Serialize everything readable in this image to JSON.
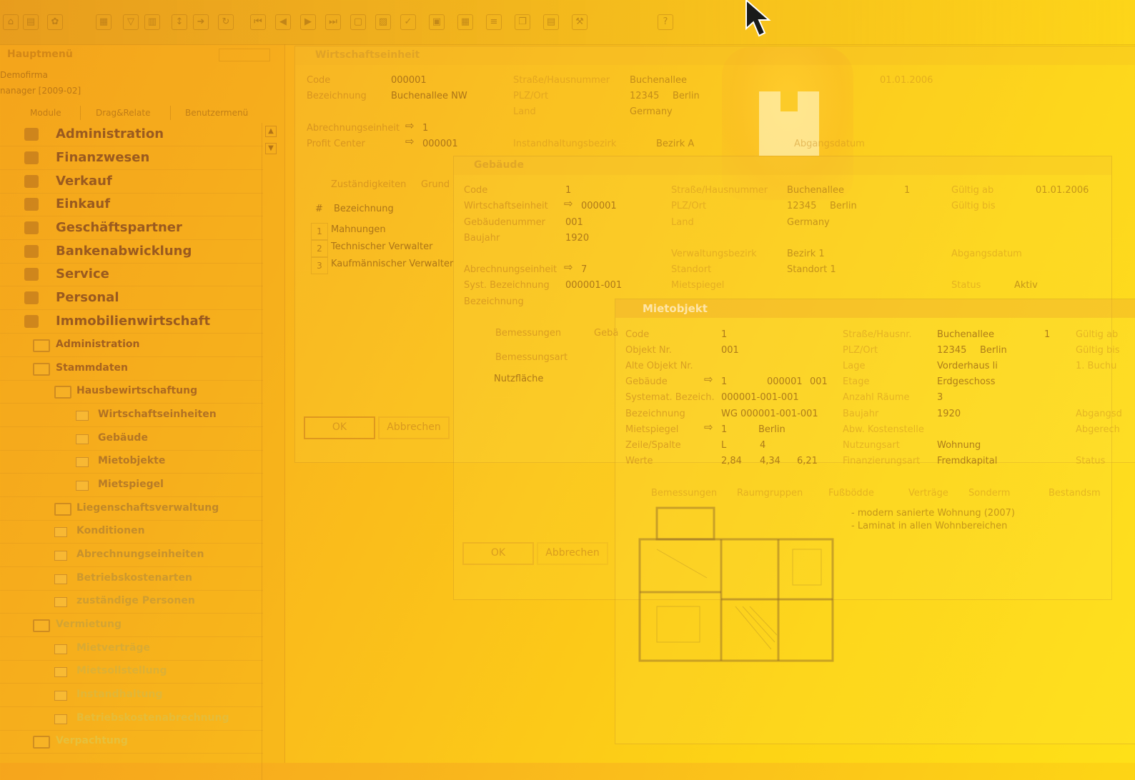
{
  "nav": {
    "title": "Hauptmenü",
    "company": "Demofirma",
    "version": "nanager  [2009-02]",
    "tabs": [
      "Module",
      "Drag&Relate",
      "Benutzermenü"
    ],
    "modules": [
      "Administration",
      "Finanzwesen",
      "Verkauf",
      "Einkauf",
      "Geschäftspartner",
      "Bankenabwicklung",
      "Service",
      "Personal",
      "Immobilienwirtschaft"
    ],
    "immo_children": {
      "administration": "Administration",
      "stammdaten": "Stammdaten",
      "hausbewirtschaftung": "Hausbewirtschaftung",
      "hb_items": [
        "Wirtschaftseinheiten",
        "Gebäude",
        "Mietobjekte",
        "Mietspiegel"
      ],
      "more": [
        "Liegenschaftsverwaltung",
        "Konditionen",
        "Abrechnungseinheiten",
        "Betriebskostenarten",
        "zuständige Personen"
      ],
      "vermietung": "Vermietung",
      "verm_items": [
        "Mietverträge",
        "Mietsollstellung",
        "Instandhaltung",
        "Betriebskostenabrechnung"
      ],
      "last": "Verpachtung"
    }
  },
  "w1": {
    "title": "Wirtschaftseinheit",
    "code_label": "Code",
    "code": "000001",
    "bez_label": "Bezeichnung",
    "bez": "Buchenallee NW",
    "str_label": "Straße/Hausnummer",
    "str": "Buchenallee",
    "plz_label": "PLZ/Ort",
    "plz": "12345",
    "ort": "Berlin",
    "land_label": "Land",
    "land": "Germany",
    "date": "01.01.2006",
    "ae_label": "Abrechnungseinheit",
    "ae": "1",
    "pc_label": "Profit Center",
    "pc": "000001",
    "ib_label": "Instandhaltungsbezirk",
    "ib": "Bezirk A",
    "abg_label": "Abgangsdatum",
    "tabs": [
      "Zuständigkeiten",
      "Grund"
    ],
    "grid_head": [
      "#",
      "Bezeichnung"
    ],
    "rows": [
      "Mahnungen",
      "Technischer Verwalter",
      "Kaufmännischer Verwalter"
    ],
    "ok": "OK",
    "cancel": "Abbrechen"
  },
  "w2": {
    "title": "Gebäude",
    "code_label": "Code",
    "code": "1",
    "we_label": "Wirtschaftseinheit",
    "we": "000001",
    "gn_label": "Gebäudenummer",
    "gn": "001",
    "bj_label": "Baujahr",
    "bj": "1920",
    "str_label": "Straße/Hausnummer",
    "str": "Buchenallee",
    "nr": "1",
    "plz_label": "PLZ/Ort",
    "plz": "12345",
    "ort": "Berlin",
    "land_label": "Land",
    "land": "Germany",
    "ga_label": "Gültig ab",
    "ga": "01.01.2006",
    "gb_label": "Gültig bis",
    "vb_label": "Verwaltungsbezirk",
    "vb": "Bezirk 1",
    "so_label": "Standort",
    "so": "Standort 1",
    "ms_label": "Mietspiegel",
    "abg_label": "Abgangsdatum",
    "status_label": "Status",
    "status": "Aktiv",
    "ae_label": "Abrechnungseinheit",
    "ae": "7",
    "sb_label": "Syst. Bezeichnung",
    "sb": "000001-001",
    "bz_label": "Bezeichnung",
    "tabs": [
      "Bemessungen",
      "Gebä"
    ],
    "col": "Bemessungsart",
    "row1": "Nutzfläche",
    "ok": "OK",
    "cancel": "Abbrechen"
  },
  "w3": {
    "title": "Mietobjekt",
    "code_label": "Code",
    "code": "1",
    "on_label": "Objekt Nr.",
    "on": "001",
    "ao_label": "Alte Objekt Nr.",
    "geb_label": "Gebäude",
    "geb": "1",
    "geb_id": "000001",
    "geb_nr": "001",
    "sb_label": "Systemat. Bezeich.",
    "sb": "000001-001-001",
    "bz_label": "Bezeichnung",
    "bz": "WG 000001-001-001",
    "ms_label": "Mietspiegel",
    "ms": "1",
    "ms_ort": "Berlin",
    "zs_label": "Zeile/Spalte",
    "zeile": "L",
    "spalte": "4",
    "w_label": "Werte",
    "w1": "2,84",
    "w2": "4,34",
    "w3": "6,21",
    "str_label": "Straße/Hausnr.",
    "str": "Buchenallee",
    "nr": "1",
    "plz_label": "PLZ/Ort",
    "plz": "12345",
    "ort": "Berlin",
    "lage_label": "Lage",
    "lage": "Vorderhaus li",
    "etage_label": "Etage",
    "etage": "Erdgeschoss",
    "az_label": "Anzahl Räume",
    "az": "3",
    "bj_label": "Baujahr",
    "bj": "1920",
    "ak_label": "Abw. Kostenstelle",
    "na_label": "Nutzungsart",
    "na": "Wohnung",
    "fa_label": "Finanzierungsart",
    "fa": "Fremdkapital",
    "ga_label": "Gültig ab",
    "gb_label": "Gültig bis",
    "buch": "1. Buchu",
    "abg_label": "Abgangsd",
    "abgr_label": "Abgerech",
    "status_label": "Status",
    "tabs": [
      "Bemessungen",
      "Raumgruppen",
      "Fußbödde",
      "Verträge",
      "Sonderm",
      "Bestandsm"
    ],
    "notes": [
      "- modern sanierte Wohnung (2007)",
      "- Laminat in allen Wohnbereichen"
    ]
  }
}
